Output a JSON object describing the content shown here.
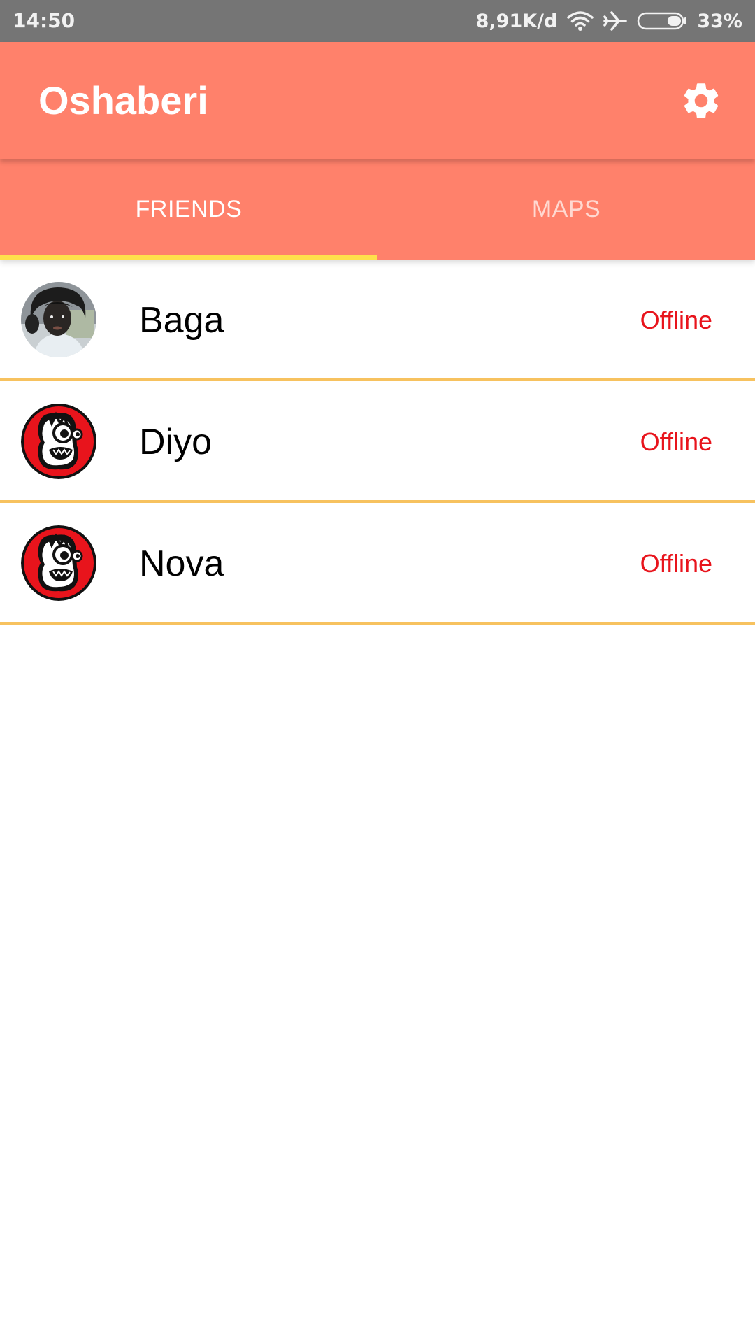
{
  "status_bar": {
    "time": "14:50",
    "network_speed": "8,91K/d",
    "battery_percent": "33%",
    "battery_level": 0.33,
    "icons": [
      "wifi-icon",
      "airplane-mode-icon",
      "battery-icon"
    ]
  },
  "app_bar": {
    "title": "Oshaberi",
    "settings_icon": "gear-icon",
    "color": "#ff816b"
  },
  "tabs": [
    {
      "label": "FRIENDS",
      "active": true
    },
    {
      "label": "MAPS",
      "active": false
    }
  ],
  "tab_indicator_color": "#ffe04b",
  "friends": [
    {
      "name": "Baga",
      "status": "Offline",
      "avatar": "photo-avatar"
    },
    {
      "name": "Diyo",
      "status": "Offline",
      "avatar": "cartoon-monster-avatar"
    },
    {
      "name": "Nova",
      "status": "Offline",
      "avatar": "cartoon-monster-avatar"
    }
  ],
  "colors": {
    "status_offline": "#e8141c",
    "row_divider": "#f7c25f"
  }
}
